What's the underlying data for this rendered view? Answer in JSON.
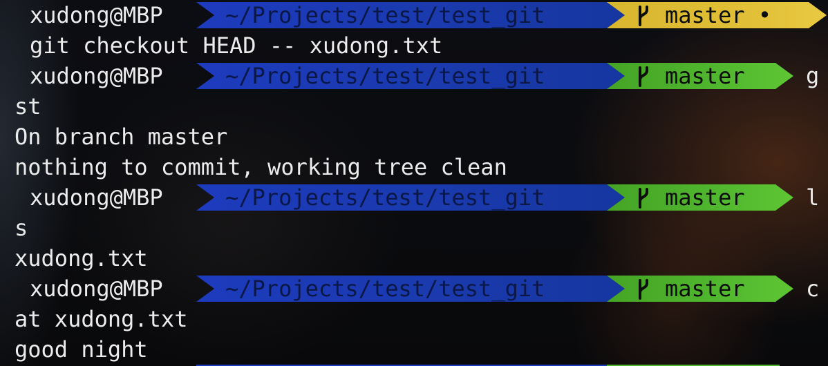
{
  "prompt": {
    "user": "xudong@MBP",
    "path": "~/Projects/test/test_git",
    "branch": "master",
    "dirty_marker": "•"
  },
  "colors": {
    "dir_segment": "#1d3bbd",
    "git_clean": "#4fb52e",
    "git_dirty": "#e0bf36"
  },
  "lines": {
    "l0_status": "master •",
    "l1_text": "git checkout HEAD -- xudong.txt",
    "l2_cmd": "g",
    "l3_text": "st",
    "l4_text": "On branch master",
    "l5_text": "nothing to commit, working tree clean",
    "l6_cmd": "l",
    "l7_text": "s",
    "l8_text": "xudong.txt",
    "l9_cmd": "c",
    "l10_text": "at xudong.txt",
    "l11_text": "good night"
  }
}
